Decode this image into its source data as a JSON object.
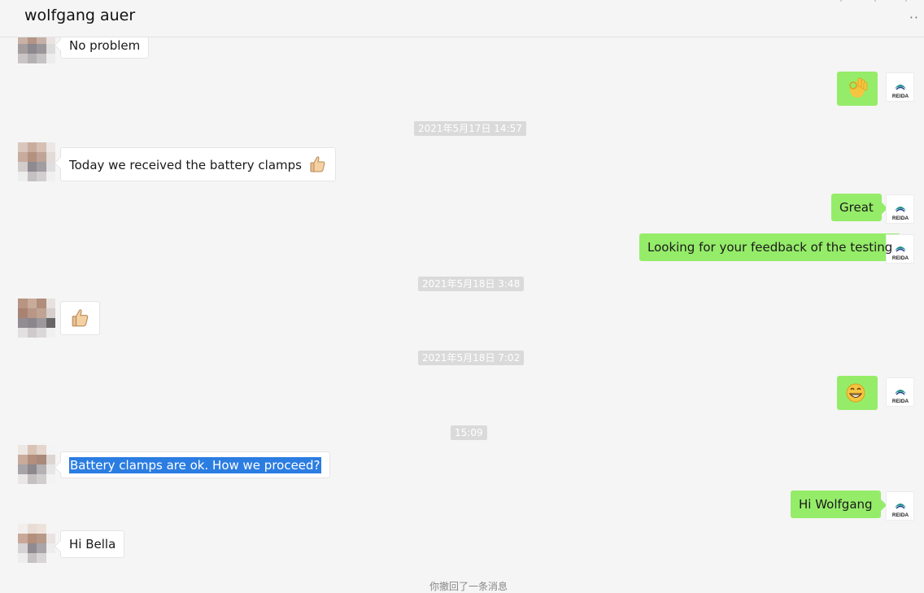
{
  "header": {
    "title": "wolfgang auer",
    "more_icon": "ellipsis-icon"
  },
  "messages": [
    {
      "text": "No problem"
    },
    {
      "emoji": "ok-hand-icon"
    },
    {
      "timestamp": "2021年5月17日 14:57"
    },
    {
      "text": "Today we received the battery clamps",
      "emoji": "thumbs-up-icon"
    },
    {
      "text": "Great"
    },
    {
      "text": "Looking for your feedback of the testing"
    },
    {
      "timestamp": "2021年5月18日 3:48"
    },
    {
      "emoji": "thumbs-up-icon"
    },
    {
      "timestamp": "2021年5月18日 7:02"
    },
    {
      "emoji": "grinning-face-icon"
    },
    {
      "timestamp": "15:09"
    },
    {
      "text": "Battery clamps are ok. How we proceed?"
    },
    {
      "text": "Hi Wolfgang"
    },
    {
      "text": "Hi Bella"
    },
    {
      "system": "你撤回了一条消息"
    }
  ],
  "self_avatar_label": "REIDA",
  "colors": {
    "outgoing_bubble": "#95ec69",
    "incoming_bubble": "#ffffff",
    "background": "#f5f5f5",
    "selection": "#2b7de1"
  }
}
